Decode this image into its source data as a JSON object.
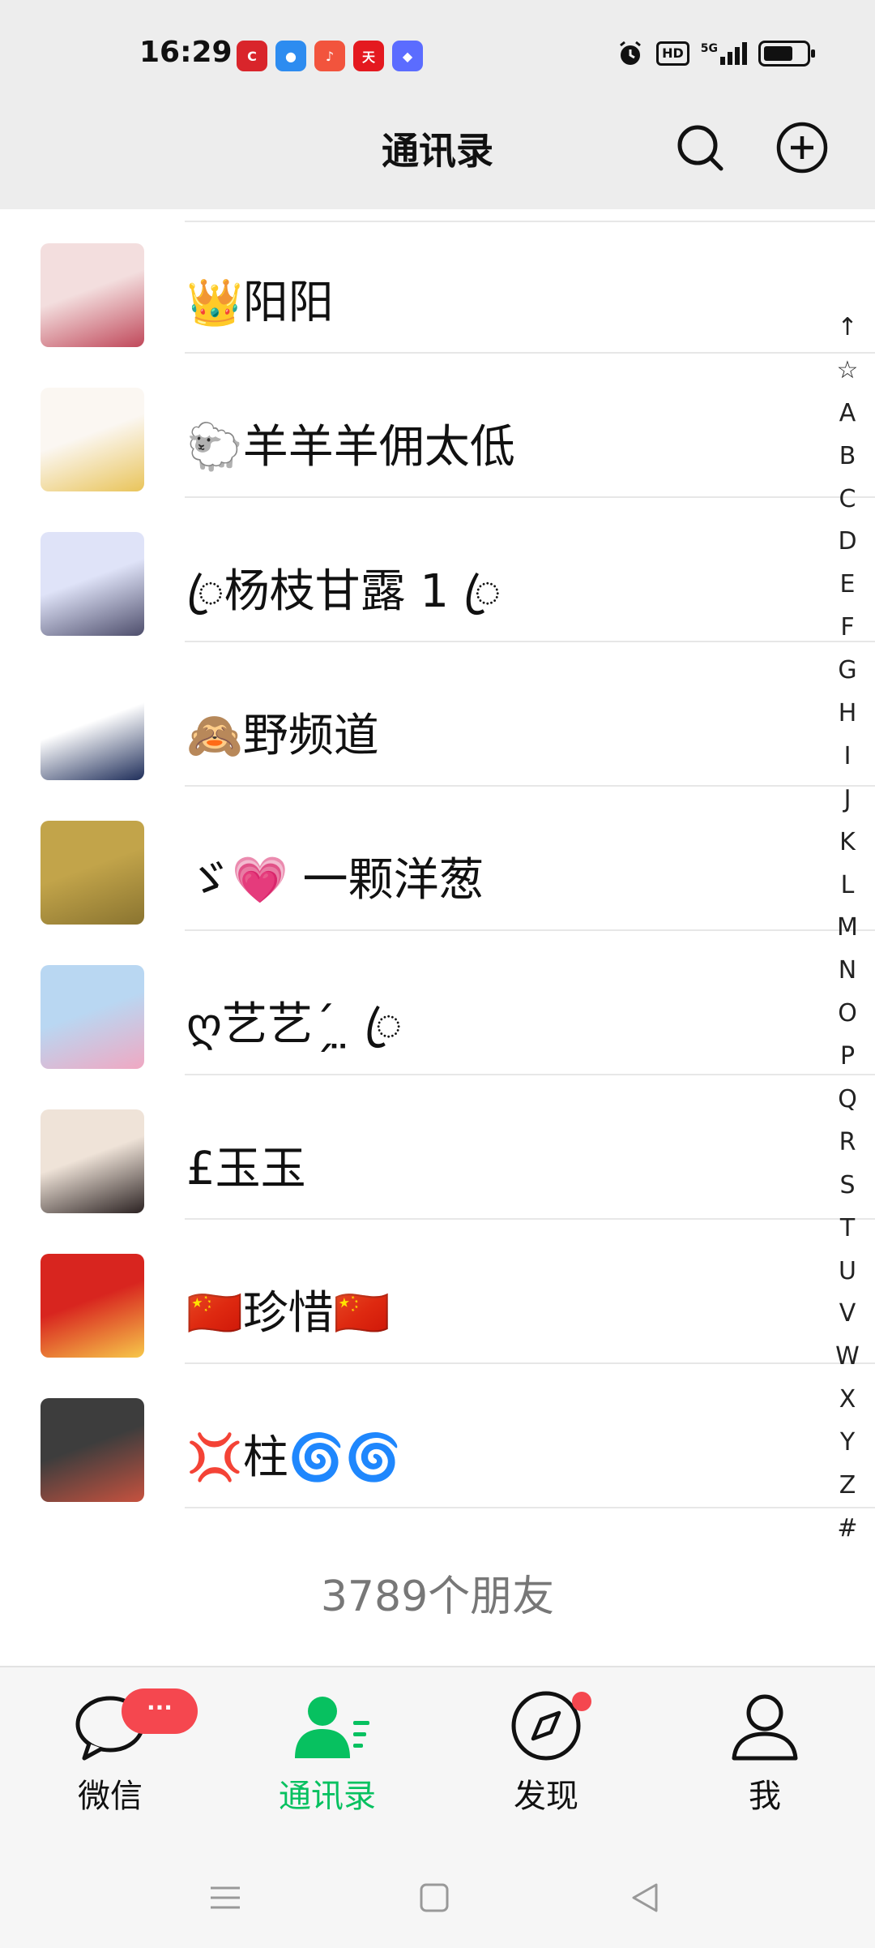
{
  "status_bar": {
    "time": "16:29",
    "app_icons": [
      {
        "name": "news-app-icon",
        "color": "#d9252b",
        "glyph": "C"
      },
      {
        "name": "browser-app-icon",
        "color": "#2d8cf0",
        "glyph": "●"
      },
      {
        "name": "music-app-icon",
        "color": "#f2543d",
        "glyph": "♪"
      },
      {
        "name": "tmall-app-icon",
        "color": "#e4191f",
        "glyph": "天"
      },
      {
        "name": "shortcut-app-icon",
        "color": "#5b6cff",
        "glyph": "◆"
      }
    ],
    "hd_label": "HD",
    "network_label": "5G",
    "battery_level": 0.8
  },
  "header": {
    "title": "通讯录",
    "search_icon": "search-icon",
    "add_icon": "plus-circle-icon"
  },
  "contacts": [
    {
      "name": "👑阳阳",
      "avatar_colors": [
        "#f3dede",
        "#c0485a"
      ]
    },
    {
      "name": "🐑羊羊羊佣太低",
      "avatar_colors": [
        "#fbf7f2",
        "#e9c45a"
      ]
    },
    {
      "name": "ꦿ杨枝甘露 1 ꦿ",
      "avatar_colors": [
        "#dfe3f8",
        "#4e4e6c"
      ]
    },
    {
      "name": "🙈野频道",
      "avatar_colors": [
        "#ffffff",
        "#1f2e5a"
      ]
    },
    {
      "name": "ゞ💗 一颗洋葱",
      "avatar_colors": [
        "#c2a44a",
        "#8a7430"
      ]
    },
    {
      "name": "ღ艺艺ˊ̗ ̤ ꦿ",
      "avatar_colors": [
        "#b9d7f2",
        "#f0a8c2"
      ]
    },
    {
      "name": "£玉玉",
      "avatar_colors": [
        "#efe3d8",
        "#2b2222"
      ]
    },
    {
      "name": "🇨🇳珍惜🇨🇳",
      "avatar_colors": [
        "#d8251f",
        "#f7c84a"
      ]
    },
    {
      "name": "💢柱🌀🌀",
      "avatar_colors": [
        "#3d3d3d",
        "#c7523f"
      ]
    }
  ],
  "contact_count": "3789个朋友",
  "index_letters": [
    "↑",
    "☆",
    "A",
    "B",
    "C",
    "D",
    "E",
    "F",
    "G",
    "H",
    "I",
    "J",
    "K",
    "L",
    "M",
    "N",
    "O",
    "P",
    "Q",
    "R",
    "S",
    "T",
    "U",
    "V",
    "W",
    "X",
    "Y",
    "Z",
    "#"
  ],
  "tabs": [
    {
      "label": "微信",
      "badge": "···"
    },
    {
      "label": "通讯录",
      "active": true
    },
    {
      "label": "发现",
      "has_dot": true
    },
    {
      "label": "我"
    }
  ],
  "colors": {
    "accent": "#07c160",
    "badge": "#f5474f",
    "header_bg": "#ededed"
  },
  "system_nav": {
    "menu_icon": "menu-icon",
    "home_icon": "home-icon",
    "back_icon": "back-icon"
  }
}
